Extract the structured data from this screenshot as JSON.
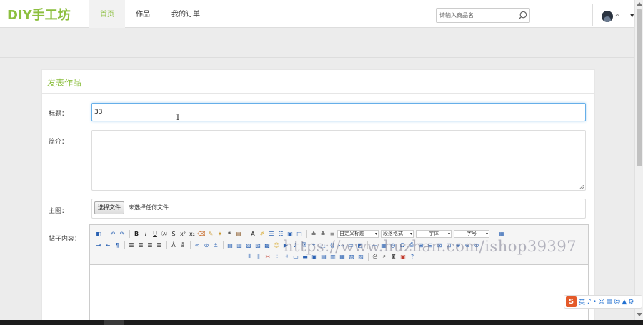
{
  "logo": "DIY手工坊",
  "nav": {
    "items": [
      "首页",
      "作品",
      "我的订单"
    ]
  },
  "search": {
    "placeholder": "请输入商品名"
  },
  "user": {
    "name": "zs"
  },
  "form": {
    "heading": "发表作品",
    "title_label": "标题：",
    "title_value": "33",
    "intro_label": "简介：",
    "cover_label": "主图：",
    "file_button": "选择文件",
    "file_status": "未选择任何文件",
    "content_label": "帖子内容："
  },
  "editor": {
    "toolbar_selects": [
      "自定义标题",
      "段落格式",
      "字体",
      "字号"
    ]
  },
  "watermark": "https://www.huzhan.com/ishop39397",
  "ime": {
    "mode": "英"
  },
  "colors": {
    "brand": "#8cbf3f",
    "focus_border": "#66afe9"
  }
}
